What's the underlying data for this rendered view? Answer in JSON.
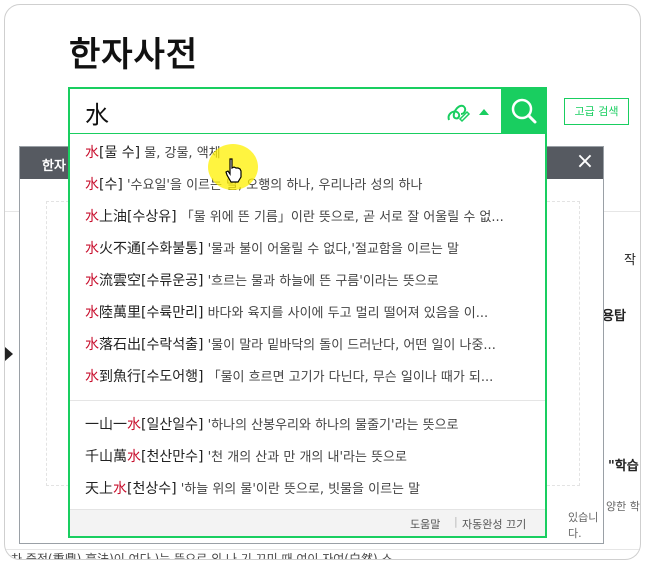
{
  "page": {
    "title": "한자사전"
  },
  "search": {
    "value": "水",
    "advanced_label": "고급 검색"
  },
  "background": {
    "dialog_title": "한자",
    "close": "×",
    "side_right_1": "작",
    "side_right_2": "용탑",
    "side_right_3": "\"학습",
    "side_right_4": "양한 학",
    "side_bottom_notice": "있습니다.",
    "bottom_line": "차 중정(重鼎) 高法)이 여다 )는 뜻으로 외 나 기 끄미 때 여이 자여(白然) 스"
  },
  "autocomplete": {
    "items": [
      {
        "hanja": "水",
        "suffix": "",
        "reading": "[물 수]",
        "desc": "물, 강물, 액체"
      },
      {
        "hanja": "水",
        "suffix": "",
        "reading": "[수]",
        "desc": "'수요일'을 이르는 말, 오행의 하나, 우리나라 성의 하나"
      },
      {
        "hanja": "水",
        "suffix": "上油",
        "reading": "[수상유]",
        "desc": "「물 위에 뜬 기름」이란 뜻으로, 곧 서로 잘 어울릴 수 없..."
      },
      {
        "hanja": "水",
        "suffix": "火不通",
        "reading": "[수화불통]",
        "desc": "'물과 불이 어울릴 수 없다,'절교함을 이르는 말"
      },
      {
        "hanja": "水",
        "suffix": "流雲空",
        "reading": "[수류운공]",
        "desc": "'흐르는 물과 하늘에 뜬 구름'이라는 뜻으로"
      },
      {
        "hanja": "水",
        "suffix": "陸萬里",
        "reading": "[수륙만리]",
        "desc": "바다와 육지를 사이에 두고 멀리 떨어져 있음을 이..."
      },
      {
        "hanja": "水",
        "suffix": "落石出",
        "reading": "[수락석출]",
        "desc": "'물이 말라 밑바닥의 돌이 드러난다, 어떤 일이 나중..."
      },
      {
        "hanja": "水",
        "suffix": "到魚行",
        "reading": "[수도어행]",
        "desc": "「물이 흐르면 고기가 다닌다, 무슨 일이나 때가 되..."
      }
    ],
    "items2": [
      {
        "prefix": "一山一",
        "hanja": "水",
        "reading": "[일산일수]",
        "desc": "'하나의 산봉우리와 하나의 물줄기'라는 뜻으로"
      },
      {
        "prefix": "千山萬",
        "hanja": "水",
        "reading": "[천산만수]",
        "desc": "'천 개의 산과 만 개의 내'라는 뜻으로"
      },
      {
        "prefix": "天上",
        "hanja": "水",
        "reading": "[천상수]",
        "desc": "'하늘 위의 물'이란 뜻으로, 빗물을 이르는 말"
      }
    ],
    "footer": {
      "help": "도움말",
      "sep": "|",
      "off": "자동완성 끄기"
    }
  },
  "colors": {
    "accent": "#19ce60",
    "highlight": "#c8102e"
  }
}
